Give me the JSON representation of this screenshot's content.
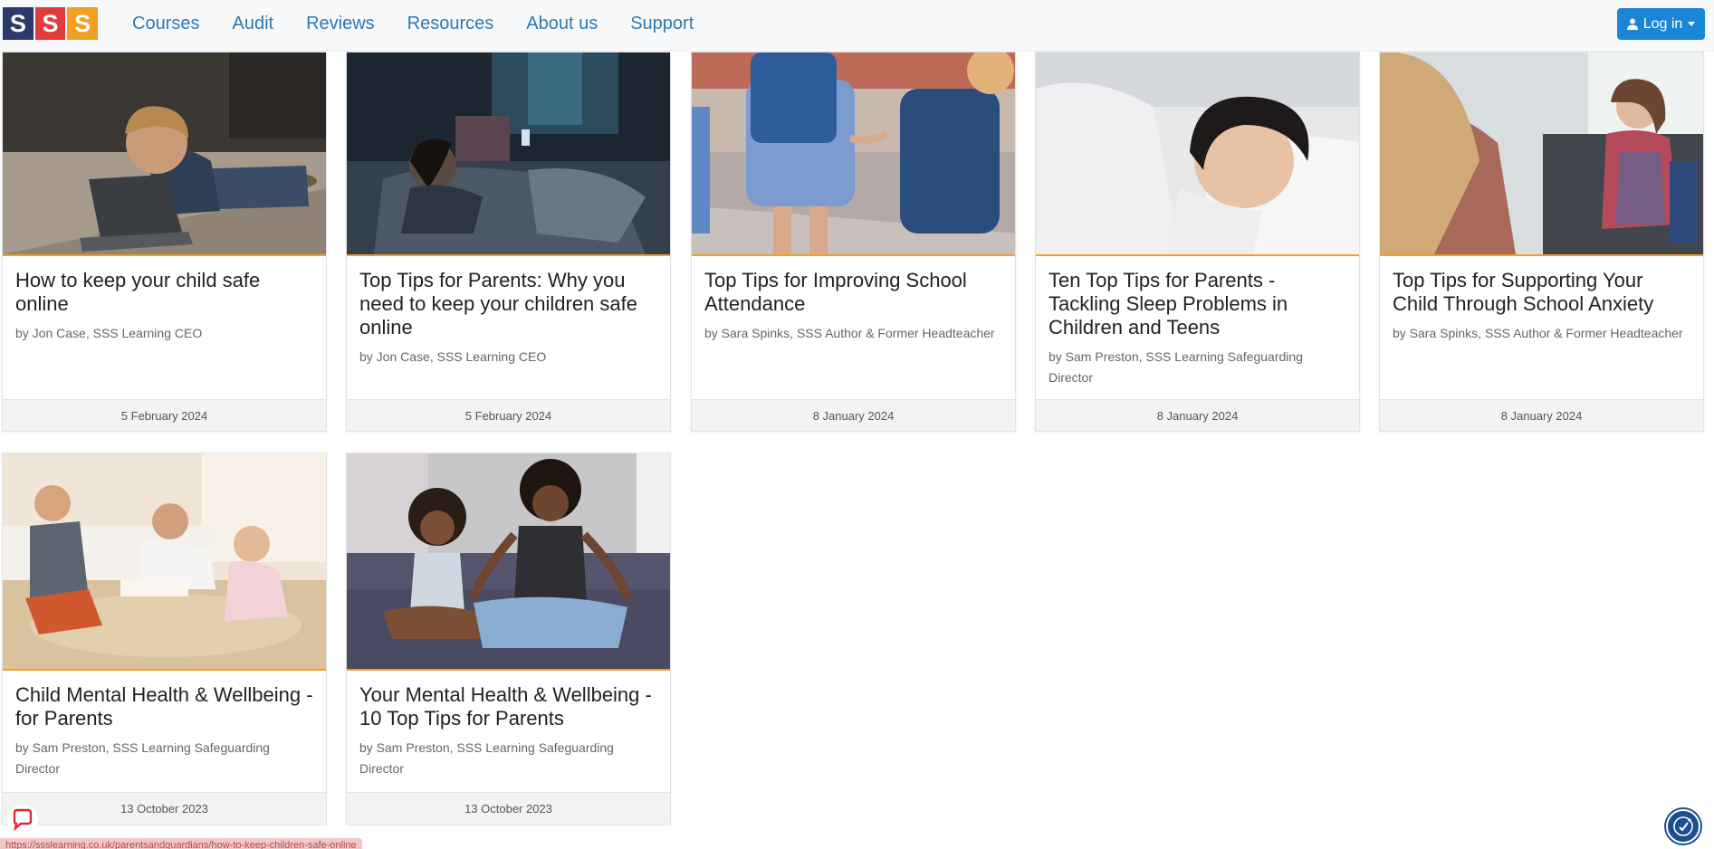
{
  "logo": {
    "letters": [
      "S",
      "S",
      "S"
    ]
  },
  "nav": {
    "links": [
      "Courses",
      "Audit",
      "Reviews",
      "Resources",
      "About us",
      "Support"
    ],
    "login_label": "Log in"
  },
  "cards": [
    {
      "title": "How to keep your child safe online",
      "author": "by Jon Case, SSS Learning CEO",
      "date": "5 February 2024",
      "image": "boy-laptop-photo"
    },
    {
      "title": "Top Tips for Parents: Why you need to keep your children safe online",
      "author": "by Jon Case, SSS Learning CEO",
      "date": "5 February 2024",
      "image": "child-phone-dark-photo"
    },
    {
      "title": "Top Tips for Improving School Attendance",
      "author": "by Sara Spinks, SSS Author & Former Headteacher",
      "date": "8 January 2024",
      "image": "children-backpacks-photo"
    },
    {
      "title": "Ten Top Tips for Parents - Tackling Sleep Problems in Children and Teens",
      "author": "by Sam Preston, SSS Learning Safeguarding Director",
      "date": "8 January 2024",
      "image": "sleeping-child-photo"
    },
    {
      "title": "Top Tips for Supporting Your Child Through School Anxiety",
      "author": "by Sara Spinks, SSS Author & Former Headteacher",
      "date": "8 January 2024",
      "image": "girl-counsellor-photo"
    },
    {
      "title": "Child Mental Health & Wellbeing - for Parents",
      "author": "by Sam Preston, SSS Learning Safeguarding Director",
      "date": "13 October 2023",
      "image": "family-reading-photo"
    },
    {
      "title": "Your Mental Health & Wellbeing - 10 Top Tips for Parents",
      "author": "by Sam Preston, SSS Learning Safeguarding Director",
      "date": "13 October 2023",
      "image": "mother-daughter-meditate-photo"
    }
  ],
  "status_bar": {
    "url": "https://ssslearning.co.uk/parentsandguardians/how-to-keep-children-safe-online"
  },
  "colors": {
    "brand_blue": "#2a7ab8",
    "button_blue": "#1a86d6",
    "accent_orange": "#f2a024",
    "logo_navy": "#2b3a67",
    "logo_red": "#e33b3b"
  }
}
